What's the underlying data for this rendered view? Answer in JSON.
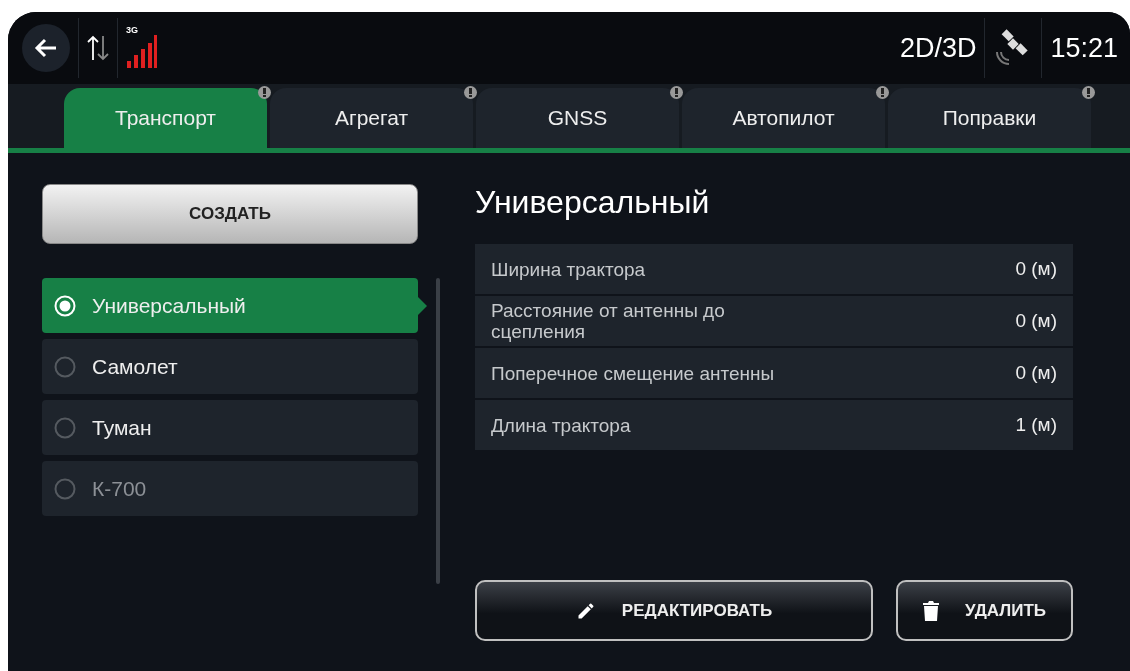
{
  "status_bar": {
    "mode": "2D/3D",
    "time": "15:21",
    "network": "3G"
  },
  "tabs": [
    {
      "label": "Транспорт",
      "selected": true,
      "alert": true
    },
    {
      "label": "Агрегат",
      "selected": false,
      "alert": true
    },
    {
      "label": "GNSS",
      "selected": false,
      "alert": true
    },
    {
      "label": "Автопилот",
      "selected": false,
      "alert": true
    },
    {
      "label": "Поправки",
      "selected": false,
      "alert": true
    }
  ],
  "create_button": "СОЗДАТЬ",
  "profiles": [
    {
      "name": "Универсальный",
      "selected": true,
      "disabled": false
    },
    {
      "name": "Самолет",
      "selected": false,
      "disabled": false
    },
    {
      "name": "Туман",
      "selected": false,
      "disabled": false
    },
    {
      "name": "К-700",
      "selected": false,
      "disabled": true
    }
  ],
  "details": {
    "title": "Универсальный",
    "rows": [
      {
        "label": "Ширина трактора",
        "value": "0 (м)"
      },
      {
        "label": "Расстояние от антенны до сцепления",
        "value": "0 (м)"
      },
      {
        "label": "Поперечное смещение антенны",
        "value": "0 (м)"
      },
      {
        "label": "Длина трактора",
        "value": "1 (м)"
      }
    ]
  },
  "actions": [
    {
      "kind": "edit",
      "label": "РЕДАКТИРОВАТЬ"
    },
    {
      "kind": "delete",
      "label": "УДАЛИТЬ"
    }
  ]
}
